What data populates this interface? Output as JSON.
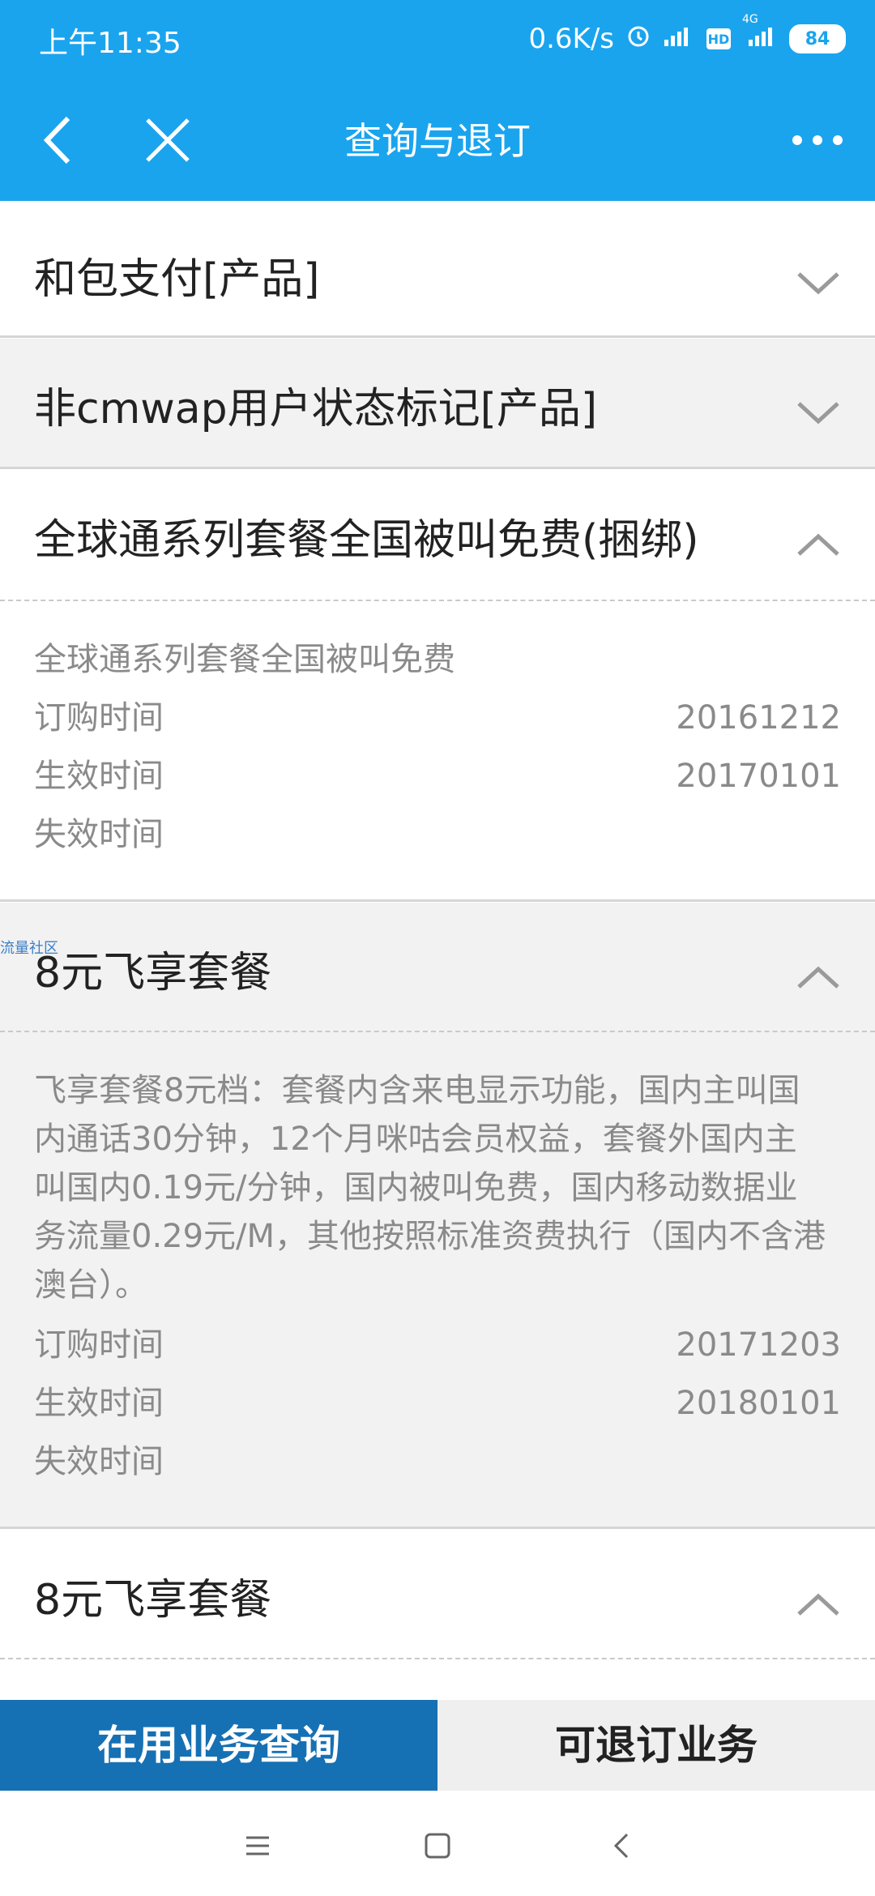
{
  "status_bar": {
    "time": "上午11:35",
    "net_speed": "0.6K/s",
    "battery": "84",
    "hd": "HD",
    "network": "4G"
  },
  "app_bar": {
    "title": "查询与退订"
  },
  "sections": [
    {
      "title": "和包支付[产品]",
      "expanded": false
    },
    {
      "title": "非cmwap用户状态标记[产品]",
      "expanded": false
    },
    {
      "title": "全球通系列套餐全国被叫免费(捆绑)",
      "expanded": true,
      "description": "全球通系列套餐全国被叫免费",
      "subscribe_label": "订购时间",
      "subscribe_value": "20161212",
      "effective_label": "生效时间",
      "effective_value": "20170101",
      "expire_label": "失效时间",
      "expire_value": ""
    },
    {
      "title": "8元飞享套餐",
      "expanded": true,
      "description_lines": [
        "飞享套餐8元档：套餐内含来电显示功能，国内主叫国",
        "内通话30分钟，12个月咪咕会员权益，套餐外国内主",
        "叫国内0.19元/分钟，国内被叫免费，国内移动数据业",
        "务流量0.29元/M，其他按照标准资费执行（国内不含港",
        "澳台）。"
      ],
      "subscribe_label": "订购时间",
      "subscribe_value": "20171203",
      "effective_label": "生效时间",
      "effective_value": "20180101",
      "expire_label": "失效时间",
      "expire_value": ""
    },
    {
      "title": "8元飞享套餐",
      "expanded": true
    }
  ],
  "watermark": "流量社区",
  "tabs": {
    "active_label": "在用业务查询",
    "inactive_label": "可退订业务"
  },
  "icons": {
    "back": "back-arrow-icon",
    "close": "close-icon",
    "more": "more-dots-icon",
    "chevron_down": "chevron-down-icon",
    "chevron_up": "chevron-up-icon"
  },
  "colors": {
    "header_blue": "#1aa4ee",
    "tab_active": "#1670b4",
    "gray_bg": "#f2f2f2",
    "detail_text": "#8a8a8a"
  }
}
